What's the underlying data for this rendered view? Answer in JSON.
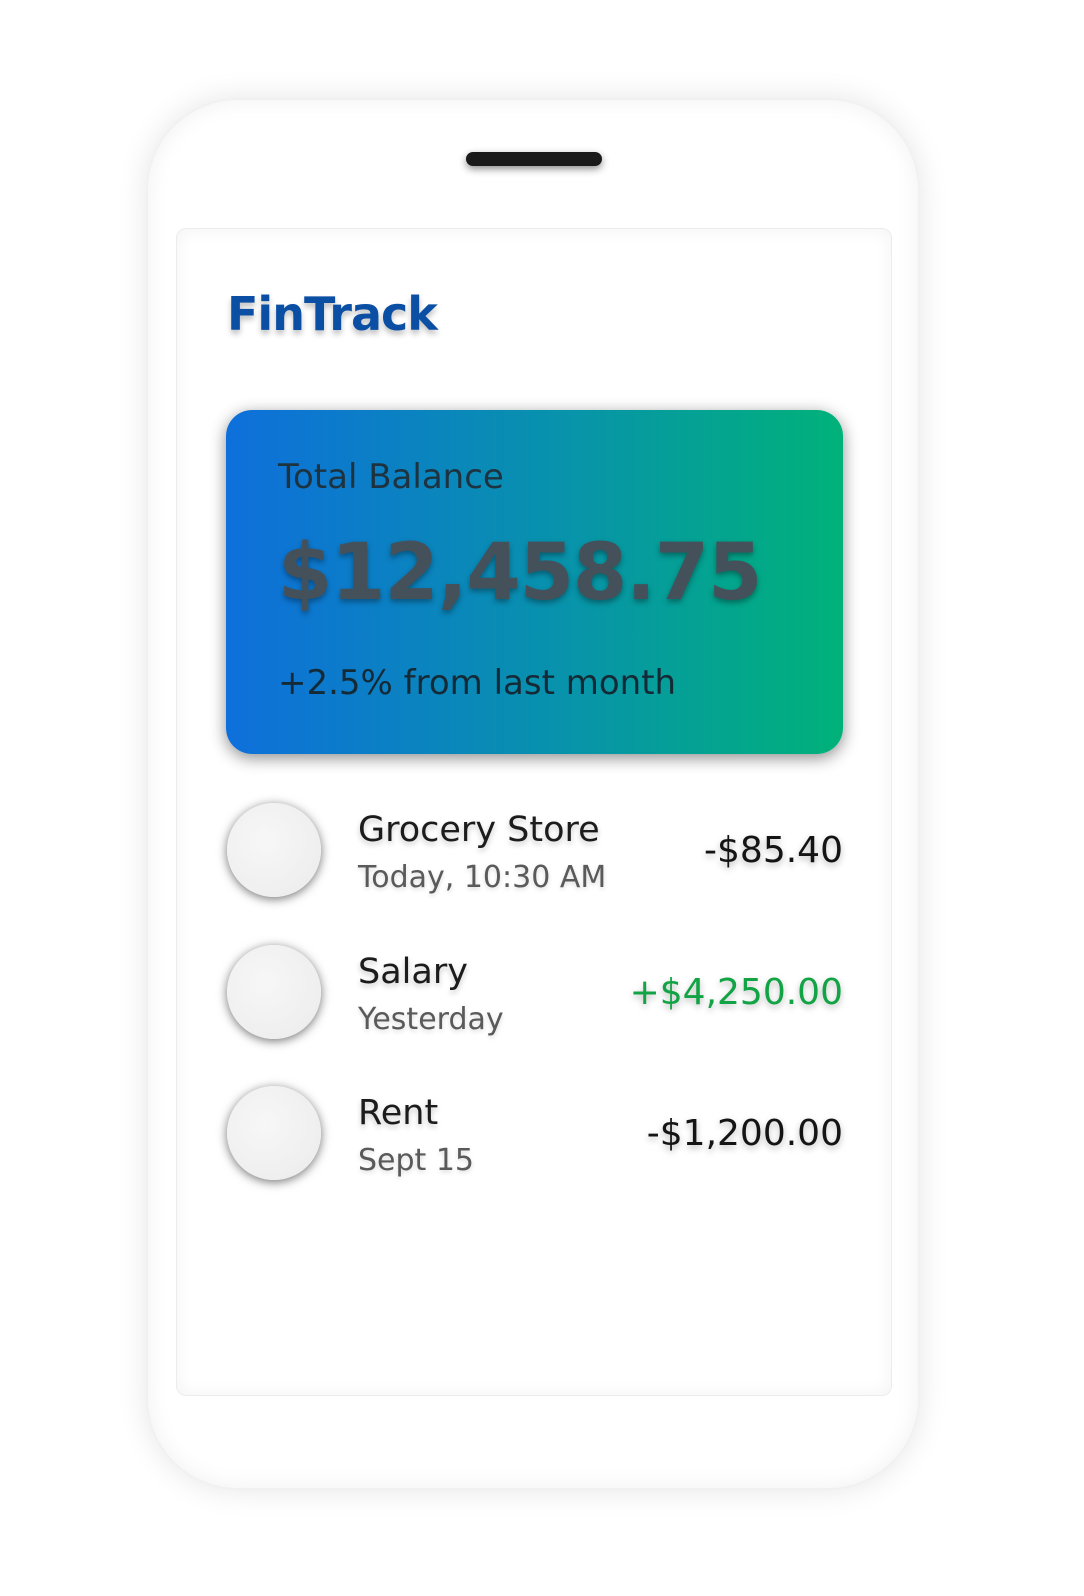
{
  "app": {
    "title": "FinTrack",
    "brand_color": "#0b4fa5"
  },
  "balance_card": {
    "label": "Total Balance",
    "amount": "$12,458.75",
    "change": "+2.5% from last month",
    "gradient": [
      "#0e6fdb",
      "#00b279"
    ]
  },
  "transactions": [
    {
      "name": "Grocery Store",
      "date": "Today, 10:30 AM",
      "amount": "-$85.40",
      "type": "debit"
    },
    {
      "name": "Salary",
      "date": "Yesterday",
      "amount": "+$4,250.00",
      "type": "credit"
    },
    {
      "name": "Rent",
      "date": "Sept 15",
      "amount": "-$1,200.00",
      "type": "debit"
    }
  ],
  "colors": {
    "credit": "#12a345",
    "debit": "#141414"
  }
}
